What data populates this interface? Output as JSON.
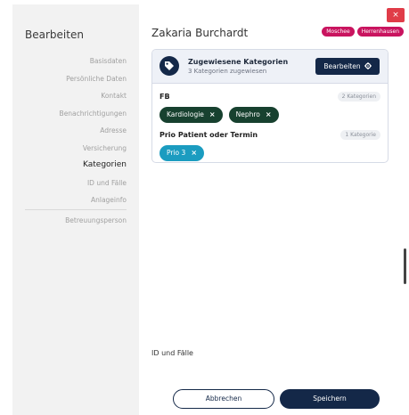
{
  "sidebar": {
    "title": "Bearbeiten",
    "items": [
      {
        "label": "Basisdaten",
        "active": false
      },
      {
        "label": "Persönliche Daten",
        "active": false
      },
      {
        "label": "Kontakt",
        "active": false
      },
      {
        "label": "Benachrichtigungen",
        "active": false
      },
      {
        "label": "Adresse",
        "active": false
      },
      {
        "label": "Versicherung",
        "active": false
      },
      {
        "label": "Kategorien",
        "active": true
      },
      {
        "label": "ID und Fälle",
        "active": false
      },
      {
        "label": "Anlageinfo",
        "active": false
      }
    ],
    "extra_item": "Betreuungsperson"
  },
  "header": {
    "close_label": "×",
    "patient_name": "Zakaria Burchardt",
    "badges": [
      "Moschee",
      "Herrenhausen"
    ]
  },
  "categories": {
    "title": "Zugewiesene Kategorien",
    "subtitle": "3 Kategorien zugewiesen",
    "edit_label": "Bearbeiten",
    "groups": [
      {
        "name": "FB",
        "count": "2 Kategorien",
        "chips": [
          {
            "label": "Kardiologie",
            "color": "#17412f"
          },
          {
            "label": "Nephro",
            "color": "#17412f"
          }
        ]
      },
      {
        "name": "Prio Patient oder Termin",
        "count": "1 Kategorie",
        "chips": [
          {
            "label": "Prio 3",
            "color": "#1b9cc0"
          }
        ]
      }
    ]
  },
  "section_label": "ID und Fälle",
  "footer": {
    "cancel_label": "Abbrechen",
    "save_label": "Speichern"
  },
  "colors": {
    "primary": "#142848",
    "danger": "#e03c48",
    "badge": "#c9145f"
  },
  "icons": {
    "tag": "tag-icon",
    "gear": "gear-icon",
    "close": "close-icon",
    "chip_remove": "close-icon"
  }
}
